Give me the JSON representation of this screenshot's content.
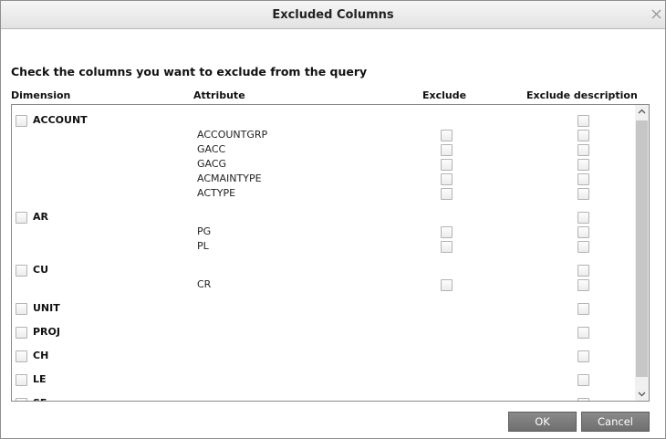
{
  "dialog": {
    "title": "Excluded Columns",
    "instruction": "Check the columns you want to exclude from the query"
  },
  "headers": {
    "dimension": "Dimension",
    "attribute": "Attribute",
    "exclude": "Exclude",
    "exclude_description": "Exclude description"
  },
  "rows": [
    {
      "type": "dimension",
      "label": "ACCOUNT"
    },
    {
      "type": "attribute",
      "label": "ACCOUNTGRP"
    },
    {
      "type": "attribute",
      "label": "GACC"
    },
    {
      "type": "attribute",
      "label": "GACG"
    },
    {
      "type": "attribute",
      "label": "ACMAINTYPE"
    },
    {
      "type": "attribute",
      "label": "ACTYPE"
    },
    {
      "type": "dimension",
      "label": "AR"
    },
    {
      "type": "attribute",
      "label": "PG"
    },
    {
      "type": "attribute",
      "label": "PL"
    },
    {
      "type": "dimension",
      "label": "CU"
    },
    {
      "type": "attribute",
      "label": "CR"
    },
    {
      "type": "dimension",
      "label": "UNIT"
    },
    {
      "type": "dimension",
      "label": "PROJ"
    },
    {
      "type": "dimension",
      "label": "CH"
    },
    {
      "type": "dimension",
      "label": "LE"
    },
    {
      "type": "dimension",
      "label": "SE"
    }
  ],
  "buttons": {
    "ok": "OK",
    "cancel": "Cancel"
  },
  "icons": {
    "close": "close-icon",
    "scroll_up": "chevron-up-icon",
    "scroll_down": "chevron-down-icon"
  },
  "colors": {
    "button_bg": "#7d7d7d",
    "titlebar_bg": "#ececec"
  }
}
